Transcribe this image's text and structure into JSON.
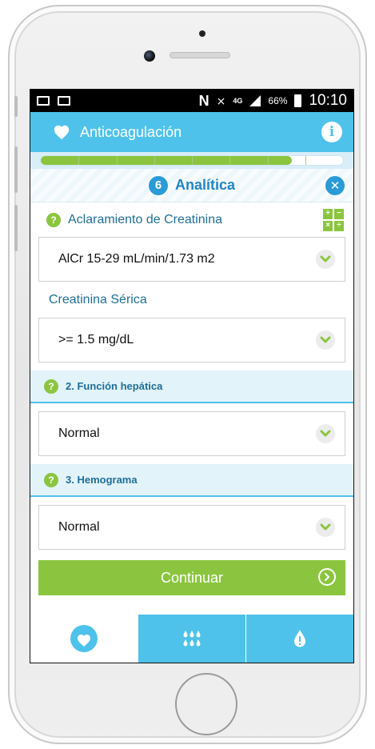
{
  "status_bar": {
    "battery_pct": "66%",
    "network": "4G",
    "time": "10:10"
  },
  "app_bar": {
    "title": "Anticoagulación"
  },
  "progress": {
    "fraction": 0.83,
    "segments": 8
  },
  "section": {
    "step_number": "6",
    "title": "Analítica"
  },
  "renal": {
    "question_label": "Aclaramiento de Creatinina",
    "calc_keys": [
      "+",
      "−",
      "×",
      "÷"
    ],
    "clearance_value": "AlCr 15-29 mL/min/1.73 m2",
    "creatinine_label": "Creatinina Sérica",
    "creatinine_value": ">= 1.5 mg/dL"
  },
  "hepatic": {
    "title": "2. Función hepática",
    "value": "Normal"
  },
  "hemogram": {
    "title": "3. Hemograma",
    "value": "Normal"
  },
  "continue_label": "Continuar",
  "bottom_nav": [
    {
      "icon": "heart-icon",
      "active": true
    },
    {
      "icon": "drops-grid-icon",
      "active": false
    },
    {
      "icon": "drop-exclamation-icon",
      "active": false
    }
  ],
  "colors": {
    "primary": "#4ec2ea",
    "accent_green": "#8bc53f",
    "section_blue": "#2a9bd6"
  }
}
